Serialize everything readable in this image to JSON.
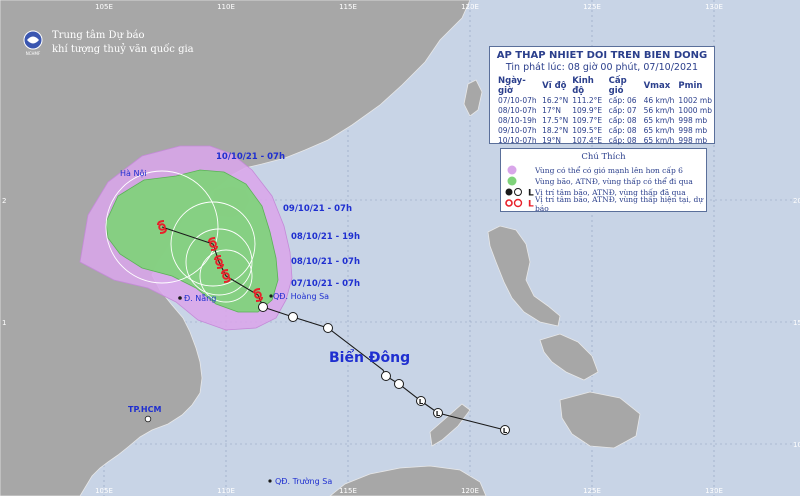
{
  "header": {
    "org_line1": "Trung tâm Dự báo",
    "org_line2": "khí tượng thuỷ văn quốc gia",
    "logo_text": "NCHMF"
  },
  "grid_labels": {
    "lon_top": [
      "105E",
      "110E",
      "115E",
      "120E",
      "125E",
      "130E"
    ],
    "lon_bottom": [
      "105E",
      "110E",
      "115E",
      "120E",
      "125E",
      "130E"
    ],
    "lat_right": [
      "20",
      "15",
      "10"
    ],
    "lat_left": [
      "2",
      "1"
    ]
  },
  "info_box": {
    "title": "AP THAP NHIET DOI TREN BIEN DONG",
    "issued": "Tin phát lúc: 08 giờ 00 phút, 07/10/2021",
    "columns": [
      "Ngày-giờ",
      "Vĩ độ",
      "Kinh độ",
      "Cấp gió",
      "Vmax",
      "Pmin"
    ],
    "rows": [
      [
        "07/10-07h",
        "16.2°N",
        "111.2°E",
        "cấp: 06",
        "46 km/h",
        "1002 mb"
      ],
      [
        "08/10-07h",
        "17°N",
        "109.9°E",
        "cấp: 07",
        "56 km/h",
        "1000 mb"
      ],
      [
        "08/10-19h",
        "17.5°N",
        "109.7°E",
        "cấp: 08",
        "65 km/h",
        "998 mb"
      ],
      [
        "09/10-07h",
        "18.2°N",
        "109.5°E",
        "cấp: 08",
        "65 km/h",
        "998 mb"
      ],
      [
        "10/10-07h",
        "19°N",
        "107.4°E",
        "cấp: 08",
        "65 km/h",
        "998 mb"
      ]
    ]
  },
  "legend": {
    "title": "Chú Thích",
    "items": [
      "Vùng có thể có gió mạnh lên hơn cấp 6",
      "Vùng bão, ATNĐ, vùng thấp có thể đi qua",
      "Vị trí tâm bão, ATNĐ, vùng thấp đã qua",
      "Vị trí tâm bão, ATNĐ, vùng thấp hiện tại, dự báo"
    ],
    "colors": {
      "wind_zone": "#d9a6ea",
      "track_zone": "#7fd37a"
    }
  },
  "forecast_labels": [
    "10/10/21 - 07h",
    "09/10/21 - 07h",
    "08/10/21 - 19h",
    "08/10/21 - 07h",
    "07/10/21 - 07h"
  ],
  "places": {
    "hanoi": "Hà Nội",
    "danang": "Đ. Nẵng",
    "hoangsa": "QĐ. Hoàng Sa",
    "hcm": "TP.HCM",
    "truongsa": "QĐ. Trường Sa",
    "sea": "Biển Đông"
  },
  "colors": {
    "sea": "#c8d4e6",
    "land": "#a7a7a7",
    "label_blue": "#1f2fd0",
    "track_line": "#1a1a1a",
    "forecast_symbol": "#e8202a"
  }
}
